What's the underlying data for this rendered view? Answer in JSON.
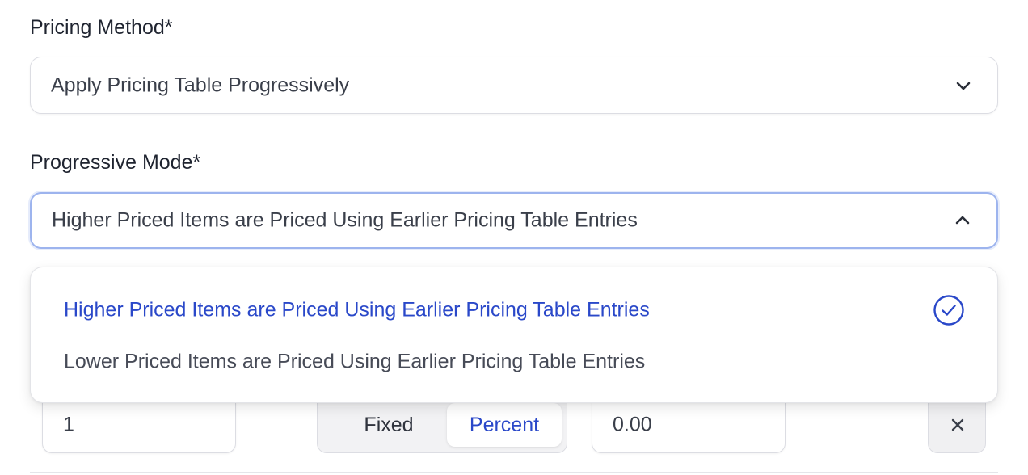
{
  "pricing_method": {
    "label": "Pricing Method*",
    "value": "Apply Pricing Table Progressively"
  },
  "progressive_mode": {
    "label": "Progressive Mode*",
    "value": "Higher Priced Items are Priced Using Earlier Pricing Table Entries",
    "options": [
      {
        "label": "Higher Priced Items are Priced Using Earlier Pricing Table Entries",
        "selected": true
      },
      {
        "label": "Lower Priced Items are Priced Using Earlier Pricing Table Entries",
        "selected": false
      }
    ]
  },
  "row": {
    "quantity": "1",
    "type_options": [
      "Fixed",
      "Percent"
    ],
    "type_selected": "Percent",
    "amount": "0.00",
    "remove_symbol": "×"
  },
  "colors": {
    "accent": "#2a48c9",
    "focus_ring": "#9db4ee"
  },
  "icons": {
    "method_chevron": "chevron-down-icon",
    "mode_chevron": "chevron-up-icon",
    "selected_check": "check-circle-icon",
    "remove": "close-icon"
  }
}
